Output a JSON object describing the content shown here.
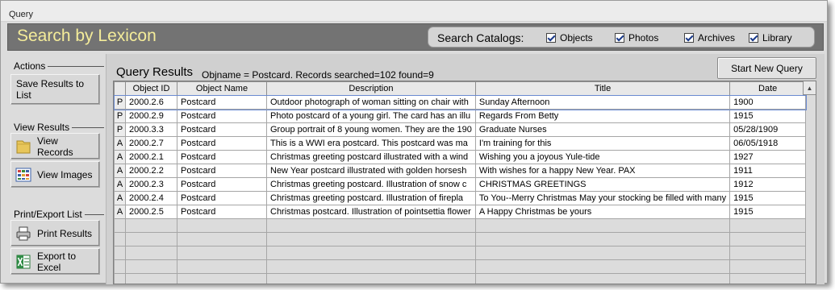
{
  "window": {
    "title": "Query"
  },
  "header": {
    "app_title": "Search by Lexicon",
    "catalogs_label": "Search Catalogs:",
    "catalogs": [
      {
        "label": "Objects",
        "checked": true
      },
      {
        "label": "Photos",
        "checked": true
      },
      {
        "label": "Archives",
        "checked": true
      },
      {
        "label": "Library",
        "checked": true
      }
    ]
  },
  "sidebar": {
    "actions_label": "Actions",
    "save_results_label": "Save Results to List",
    "view_results_label": "View Results",
    "view_records_label": "View Records",
    "view_images_label": "View Images",
    "print_export_label": "Print/Export List",
    "print_results_label": "Print Results",
    "export_excel_label": "Export to Excel"
  },
  "main": {
    "results_title": "Query Results",
    "results_info": "Objname = Postcard.   Records searched=102 found=9",
    "new_query_label": "Start New Query"
  },
  "table": {
    "columns": [
      "Object ID",
      "Object Name",
      "Description",
      "Title",
      "Date"
    ],
    "rows": [
      {
        "sel": "P",
        "id": "2000.2.6",
        "name": "Postcard",
        "desc": "Outdoor photograph of woman sitting on chair with",
        "title": "Sunday Afternoon",
        "date": "1900"
      },
      {
        "sel": "P",
        "id": "2000.2.9",
        "name": "Postcard",
        "desc": "Photo postcard of a young girl.  The card has an illu",
        "title": "Regards From Betty",
        "date": "1915"
      },
      {
        "sel": "P",
        "id": "2000.3.3",
        "name": "Postcard",
        "desc": "Group portrait of 8 young women. They are the 190",
        "title": "Graduate Nurses",
        "date": "05/28/1909"
      },
      {
        "sel": "A",
        "id": "2000.2.7",
        "name": "Postcard",
        "desc": "This is a WWI era postcard.  This postcard was ma",
        "title": "I'm training for this",
        "date": "06/05/1918"
      },
      {
        "sel": "A",
        "id": "2000.2.1",
        "name": "Postcard",
        "desc": "Christmas greeting postcard illustrated with a wind",
        "title": "Wishing you a joyous Yule-tide",
        "date": "1927"
      },
      {
        "sel": "A",
        "id": "2000.2.2",
        "name": "Postcard",
        "desc": "New Year postcard illustrated with golden horsesh",
        "title": "With wishes for a happy New Year. PAX",
        "date": "1911"
      },
      {
        "sel": "A",
        "id": "2000.2.3",
        "name": "Postcard",
        "desc": "Christmas greeting postcard.  Illustration of snow c",
        "title": "CHRISTMAS GREETINGS",
        "date": "1912"
      },
      {
        "sel": "A",
        "id": "2000.2.4",
        "name": "Postcard",
        "desc": "Christmas greeting postcard.  Illustration of firepla",
        "title": "To You--Merry Christmas May your stocking be filled with many",
        "date": "1915"
      },
      {
        "sel": "A",
        "id": "2000.2.5",
        "name": "Postcard",
        "desc": "Christmas postcard. Illustration of pointsettia flower",
        "title": "A Happy Christmas be yours",
        "date": "1915"
      }
    ]
  },
  "colors": {
    "header_bg": "#737373",
    "title_accent": "#f4ec9a",
    "window_bg": "#dcdcdc"
  }
}
